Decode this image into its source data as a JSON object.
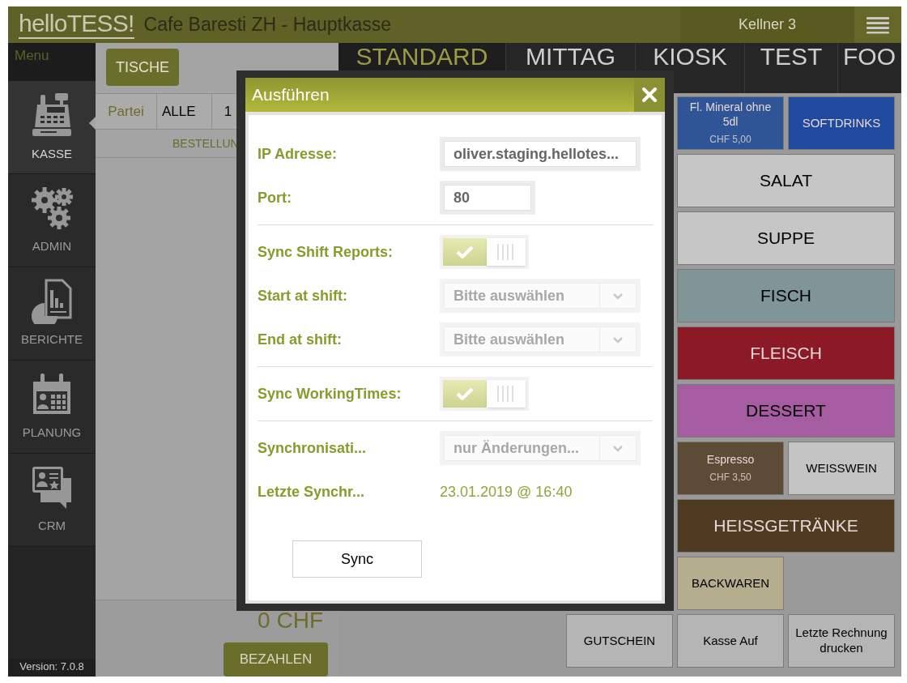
{
  "header": {
    "logo": "hello**TESS!**",
    "title": "Cafe Baresti ZH - Hauptkasse",
    "user": "Kellner 3"
  },
  "sidebar": {
    "heading": "Menu",
    "items": [
      {
        "label": "KASSE",
        "selected": true
      },
      {
        "label": "ADMIN",
        "selected": false
      },
      {
        "label": "BERICHTE",
        "selected": false
      },
      {
        "label": "PLANUNG",
        "selected": false
      },
      {
        "label": "CRM",
        "selected": false
      }
    ],
    "version": "Version: 7.0.8"
  },
  "order_panel": {
    "tables_button": "TISCHE",
    "party_label": "Partei",
    "parties": [
      "ALLE",
      "1"
    ],
    "order_heading": "BESTELLUN",
    "total": "0 CHF",
    "pay_button": "BEZAHLEN"
  },
  "tabs": [
    {
      "label": "STANDARD",
      "selected": true
    },
    {
      "label": "MITTAG",
      "selected": false
    },
    {
      "label": "KIOSK",
      "selected": false
    },
    {
      "label": "TEST",
      "selected": false
    },
    {
      "label": "FOO",
      "selected": false
    }
  ],
  "products": [
    [
      {
        "kind": "single",
        "label": "Fl. Mineral ohne 5dl",
        "price": "CHF 5,00",
        "color": "#2f5597"
      },
      {
        "kind": "single",
        "label": "SOFTDRINKS",
        "color": "#1f4a9e"
      }
    ],
    [
      {
        "kind": "wide",
        "label": "SALAT",
        "color": "#c6c6c6"
      }
    ],
    [
      {
        "kind": "wide",
        "label": "SUPPE",
        "color": "#c6c6c6"
      }
    ],
    [
      {
        "kind": "wide",
        "label": "FISCH",
        "color": "#7f9598"
      }
    ],
    [
      {
        "kind": "wide",
        "label": "FLEISCH",
        "color": "#8b1a26"
      }
    ],
    [
      {
        "kind": "wide",
        "label": "DESSERT",
        "color": "#a65ca0"
      }
    ],
    [
      {
        "kind": "single",
        "label": "Espresso",
        "price": "CHF 3,50",
        "color": "#5e4b35"
      },
      {
        "kind": "single",
        "label": "WEISSWEIN",
        "color": "#c4c4c4"
      }
    ],
    [
      {
        "kind": "wide",
        "label": "HEISSGETRÄNKE",
        "color": "#4f3a22"
      }
    ],
    [
      {
        "kind": "single",
        "label": "BACKWAREN",
        "color": "#b4ae8e"
      }
    ],
    [
      {
        "kind": "single",
        "label": "GUTSCHEIN",
        "color": "#b5b5b5"
      },
      {
        "kind": "single",
        "label": "Kasse Auf",
        "color": "#b5b5b5"
      },
      {
        "kind": "single",
        "label": "Letzte Rechnung drucken",
        "color": "#b5b5b5"
      }
    ]
  ],
  "dialog": {
    "title": "Ausführen",
    "sections": [
      [
        {
          "kind": "text",
          "label": "IP Adresse:",
          "value": "oliver.staging.hellotes..."
        },
        {
          "kind": "text",
          "label": "Port:",
          "value": "80"
        }
      ],
      [
        {
          "kind": "toggle",
          "label": "Sync Shift Reports:",
          "on": true
        },
        {
          "kind": "select",
          "label": "Start at shift:",
          "value": "Bitte auswählen",
          "disabled": true
        },
        {
          "kind": "select",
          "label": "End at shift:",
          "value": "Bitte auswählen",
          "disabled": true
        }
      ],
      [
        {
          "kind": "toggle",
          "label": "Sync WorkingTimes:",
          "on": true
        }
      ],
      [
        {
          "kind": "select",
          "label": "Synchronisati...",
          "value": "nur Änderungen...",
          "disabled": true
        },
        {
          "kind": "info",
          "label": "Letzte Synchr...",
          "value": "23.01.2019 @ 16:40"
        }
      ]
    ],
    "sync_button": "Sync"
  }
}
